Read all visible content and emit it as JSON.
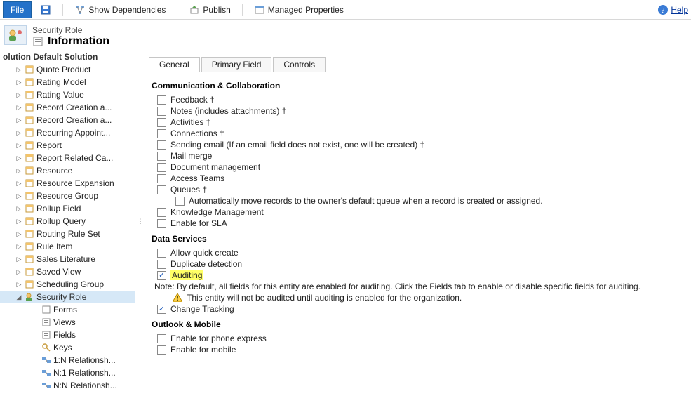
{
  "toolbar": {
    "file": "File",
    "show_deps": "Show Dependencies",
    "publish": "Publish",
    "managed_props": "Managed Properties",
    "help": "Help"
  },
  "header": {
    "entity": "Security Role",
    "page": "Information"
  },
  "sidebar": {
    "title": "olution Default Solution",
    "items": [
      {
        "label": "Quote Product",
        "depth": 1,
        "exp": "▷"
      },
      {
        "label": "Rating Model",
        "depth": 1,
        "exp": "▷"
      },
      {
        "label": "Rating Value",
        "depth": 1,
        "exp": "▷"
      },
      {
        "label": "Record Creation a...",
        "depth": 1,
        "exp": "▷"
      },
      {
        "label": "Record Creation a...",
        "depth": 1,
        "exp": "▷"
      },
      {
        "label": "Recurring Appoint...",
        "depth": 1,
        "exp": "▷"
      },
      {
        "label": "Report",
        "depth": 1,
        "exp": "▷"
      },
      {
        "label": "Report Related Ca...",
        "depth": 1,
        "exp": "▷"
      },
      {
        "label": "Resource",
        "depth": 1,
        "exp": "▷"
      },
      {
        "label": "Resource Expansion",
        "depth": 1,
        "exp": "▷"
      },
      {
        "label": "Resource Group",
        "depth": 1,
        "exp": "▷"
      },
      {
        "label": "Rollup Field",
        "depth": 1,
        "exp": "▷"
      },
      {
        "label": "Rollup Query",
        "depth": 1,
        "exp": "▷"
      },
      {
        "label": "Routing Rule Set",
        "depth": 1,
        "exp": "▷"
      },
      {
        "label": "Rule Item",
        "depth": 1,
        "exp": "▷"
      },
      {
        "label": "Sales Literature",
        "depth": 1,
        "exp": "▷"
      },
      {
        "label": "Saved View",
        "depth": 1,
        "exp": "▷"
      },
      {
        "label": "Scheduling Group",
        "depth": 1,
        "exp": "▷"
      },
      {
        "label": "Security Role",
        "depth": 1,
        "exp": "◢",
        "selected": true
      },
      {
        "label": "Forms",
        "depth": 2
      },
      {
        "label": "Views",
        "depth": 2
      },
      {
        "label": "Fields",
        "depth": 2
      },
      {
        "label": "Keys",
        "depth": 2
      },
      {
        "label": "1:N Relationsh...",
        "depth": 2
      },
      {
        "label": "N:1 Relationsh...",
        "depth": 2
      },
      {
        "label": "N:N Relationsh...",
        "depth": 2
      }
    ]
  },
  "tabs": {
    "items": [
      "General",
      "Primary Field",
      "Controls"
    ],
    "active": 0
  },
  "sections": {
    "comm": {
      "title": "Communication & Collaboration",
      "rows": [
        {
          "label": "Feedback †",
          "checked": false
        },
        {
          "label": "Notes (includes attachments) †",
          "checked": false
        },
        {
          "label": "Activities †",
          "checked": false
        },
        {
          "label": "Connections †",
          "checked": false
        },
        {
          "label": "Sending email (If an email field does not exist, one will be created) †",
          "checked": false
        },
        {
          "label": "Mail merge",
          "checked": false
        },
        {
          "label": "Document management",
          "checked": false
        },
        {
          "label": "Access Teams",
          "checked": false
        },
        {
          "label": "Queues †",
          "checked": false
        }
      ],
      "queues_sub": {
        "label": "Automatically move records to the owner's default queue when a record is created or assigned.",
        "checked": false
      },
      "extra": [
        {
          "label": "Knowledge Management",
          "checked": false
        },
        {
          "label": "Enable for SLA",
          "checked": false
        }
      ]
    },
    "data": {
      "title": "Data Services",
      "rows": [
        {
          "label": "Allow quick create",
          "checked": false
        },
        {
          "label": "Duplicate detection",
          "checked": false
        }
      ],
      "auditing": {
        "label": "Auditing",
        "checked": true
      },
      "note": "Note: By default, all fields for this entity are enabled for auditing. Click the Fields tab to enable or disable specific fields for auditing.",
      "warn": "This entity will not be audited until auditing is enabled for the organization.",
      "change_tracking": {
        "label": "Change Tracking",
        "checked": true
      }
    },
    "outlook": {
      "title": "Outlook & Mobile",
      "rows": [
        {
          "label": "Enable for phone express",
          "checked": false
        },
        {
          "label": "Enable for mobile",
          "checked": false
        }
      ]
    }
  }
}
